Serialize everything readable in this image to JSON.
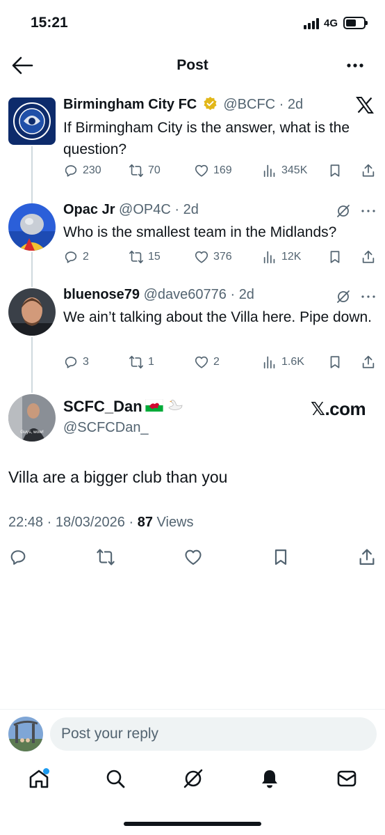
{
  "status_bar": {
    "time": "15:21",
    "network": "4G"
  },
  "header": {
    "title": "Post"
  },
  "thread": [
    {
      "name": "Birmingham City FC",
      "handle": "@BCFC",
      "time": "2d",
      "text": "If Birmingham City is the answer, what is the question?",
      "replies": "230",
      "reposts": "70",
      "likes": "169",
      "views": "345K"
    },
    {
      "name": "Opac Jr",
      "handle": "@OP4C",
      "time": "2d",
      "text": "Who is the smallest team in the Midlands?",
      "replies": "2",
      "reposts": "15",
      "likes": "376",
      "views": "12K"
    },
    {
      "name": "bluenose79",
      "handle": "@dave60776",
      "time": "2d",
      "text": "We ain’t talking about the Villa here. Pipe down.",
      "replies": "3",
      "reposts": "1",
      "likes": "2",
      "views": "1.6K"
    }
  ],
  "main_post": {
    "name": "SCFC_Dan",
    "handle": "@SCFCDan_",
    "watermark": "𝕏.com",
    "avatar_caption": "Guys, wow!",
    "text": "Villa are a bigger club than you",
    "timestamp": "22:48 · 18/03/2026 ·",
    "views_count": "87",
    "views_label": "Views"
  },
  "reply": {
    "placeholder": "Post your reply"
  },
  "colors": {
    "text": "#0f1419",
    "secondary": "#536471",
    "accent": "#1d9bf0",
    "verified": "#e2b719"
  },
  "icons": [
    "back-arrow-icon",
    "more-icon",
    "x-logo-icon",
    "verified-badge-icon",
    "reply-icon",
    "repost-icon",
    "like-icon",
    "views-icon",
    "bookmark-icon",
    "share-icon",
    "grok-icon",
    "wales-flag-icon",
    "swan-icon",
    "home-icon",
    "search-icon",
    "notifications-icon",
    "messages-icon"
  ]
}
